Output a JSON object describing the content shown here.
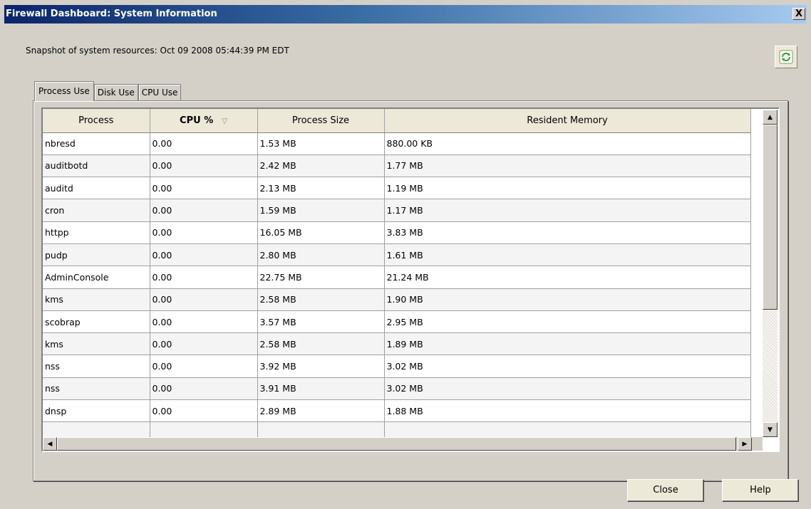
{
  "window": {
    "title": "Firewall Dashboard: System Information",
    "close_label": "X"
  },
  "snapshot_text": "Snapshot of system resources: Oct 09 2008 05:44:39 PM EDT",
  "refresh_icon": "refresh-icon",
  "tabs": [
    {
      "label": "Process Use",
      "active": true
    },
    {
      "label": "Disk Use",
      "active": false
    },
    {
      "label": "CPU Use",
      "active": false
    }
  ],
  "table": {
    "columns": [
      "Process",
      "CPU %",
      "Process Size",
      "Resident Memory"
    ],
    "sorted_column": "CPU %",
    "sort_arrow": "▽",
    "rows": [
      [
        "nbresd",
        "0.00",
        "1.53 MB",
        "880.00 KB"
      ],
      [
        "auditbotd",
        "0.00",
        "2.42 MB",
        "1.77 MB"
      ],
      [
        "auditd",
        "0.00",
        "2.13 MB",
        "1.19 MB"
      ],
      [
        "cron",
        "0.00",
        "1.59 MB",
        "1.17 MB"
      ],
      [
        "httpp",
        "0.00",
        "16.05 MB",
        "3.83 MB"
      ],
      [
        "pudp",
        "0.00",
        "2.80 MB",
        "1.61 MB"
      ],
      [
        "AdminConsole",
        "0.00",
        "22.75 MB",
        "21.24 MB"
      ],
      [
        "kms",
        "0.00",
        "2.58 MB",
        "1.90 MB"
      ],
      [
        "scobrap",
        "0.00",
        "3.57 MB",
        "2.95 MB"
      ],
      [
        "kms",
        "0.00",
        "2.58 MB",
        "1.89 MB"
      ],
      [
        "nss",
        "0.00",
        "3.92 MB",
        "3.02 MB"
      ],
      [
        "nss",
        "0.00",
        "3.91 MB",
        "3.02 MB"
      ],
      [
        "dnsp",
        "0.00",
        "2.89 MB",
        "1.88 MB"
      ]
    ]
  },
  "buttons": {
    "close": "Close",
    "help": "Help"
  },
  "scrollbar_arrows": {
    "up": "▲",
    "down": "▼",
    "left": "◀",
    "right": "▶"
  }
}
